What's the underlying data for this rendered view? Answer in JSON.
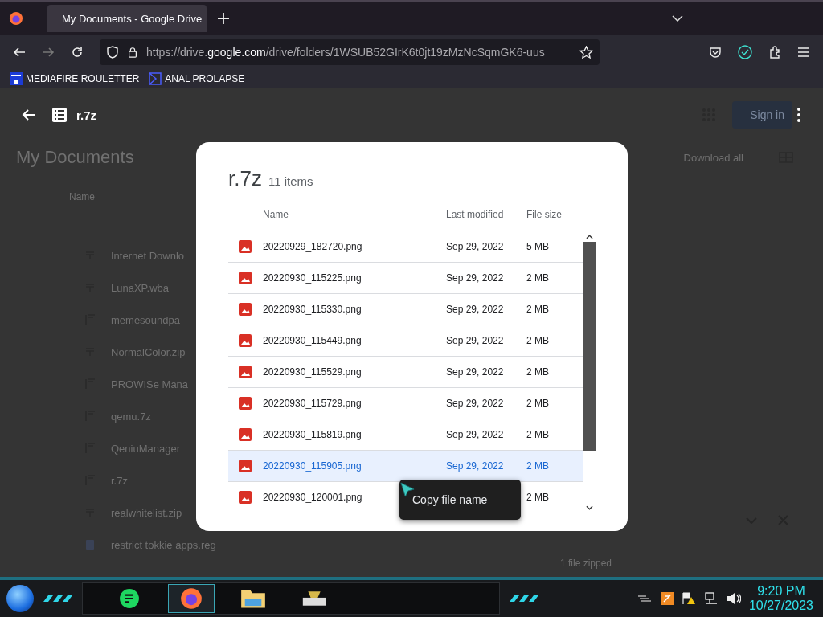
{
  "browser": {
    "tab_title": "My Documents - Google Drive",
    "url_prefix": "https://drive.",
    "url_domain": "google.com",
    "url_path": "/drive/folders/1WSUB52GIrK6t0jt19zMzNcSqmGK6-uus",
    "bookmarks": [
      {
        "label": "MEDIAFIRE ROULETTER",
        "kind": "mft"
      },
      {
        "label": "ANAL PROLAPSE",
        "kind": "sigma"
      }
    ]
  },
  "viewer": {
    "title": "r.7z"
  },
  "page": {
    "heading": "My Documents",
    "name_column": "Name",
    "download_all": "Download all",
    "sign_in": "Sign in",
    "status": "1 file zipped",
    "files": [
      {
        "name": "Internet Downlo",
        "kind": "zip"
      },
      {
        "name": "LunaXP.wba",
        "kind": "zip"
      },
      {
        "name": "memesoundpa",
        "kind": "archive"
      },
      {
        "name": "NormalColor.zip",
        "kind": "zip"
      },
      {
        "name": "PROWISe Mana",
        "kind": "archive"
      },
      {
        "name": "qemu.7z",
        "kind": "archive"
      },
      {
        "name": "QeniuManager",
        "kind": "archive"
      },
      {
        "name": "r.7z",
        "kind": "archive"
      },
      {
        "name": "realwhitelist.zip",
        "kind": "zip"
      },
      {
        "name": "restrict tokkie apps.reg",
        "kind": "doc"
      }
    ]
  },
  "dialog": {
    "title": "r.7z",
    "count": "11 items",
    "columns": [
      "Name",
      "Last modified",
      "File size"
    ],
    "rows": [
      {
        "name": "20220929_182720.png",
        "modified": "Sep 29, 2022",
        "size": "5 MB",
        "selected": false
      },
      {
        "name": "20220930_115225.png",
        "modified": "Sep 29, 2022",
        "size": "2 MB",
        "selected": false
      },
      {
        "name": "20220930_115330.png",
        "modified": "Sep 29, 2022",
        "size": "2 MB",
        "selected": false
      },
      {
        "name": "20220930_115449.png",
        "modified": "Sep 29, 2022",
        "size": "2 MB",
        "selected": false
      },
      {
        "name": "20220930_115529.png",
        "modified": "Sep 29, 2022",
        "size": "2 MB",
        "selected": false
      },
      {
        "name": "20220930_115729.png",
        "modified": "Sep 29, 2022",
        "size": "2 MB",
        "selected": false
      },
      {
        "name": "20220930_115819.png",
        "modified": "Sep 29, 2022",
        "size": "2 MB",
        "selected": false
      },
      {
        "name": "20220930_115905.png",
        "modified": "Sep 29, 2022",
        "size": "2 MB",
        "selected": true
      },
      {
        "name": "20220930_120001.png",
        "size": "2 MB",
        "selected": false
      }
    ]
  },
  "tooltip": "Copy file name",
  "taskbar": {
    "time": "9:20 PM",
    "date": "10/27/2023"
  }
}
